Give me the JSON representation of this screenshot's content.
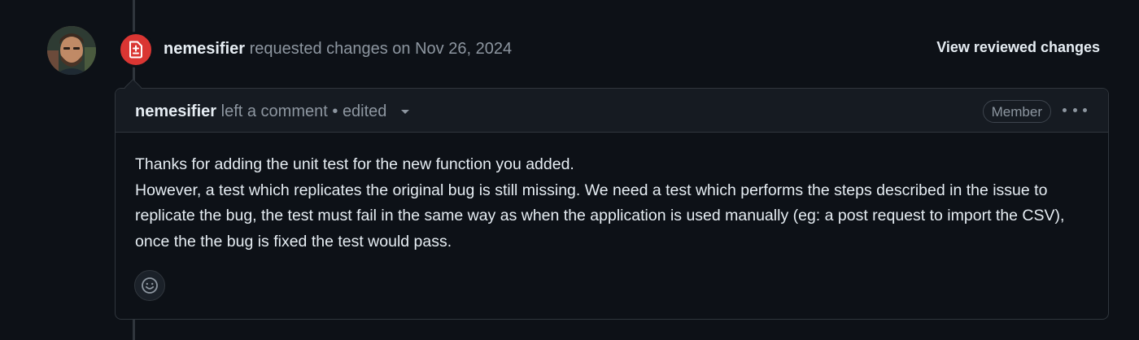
{
  "review": {
    "author": "nemesifier",
    "action_text": "requested changes on Nov 26, 2024",
    "view_changes_label": "View reviewed changes",
    "status_color": "#da3633",
    "status_icon": "file-diff-icon"
  },
  "comment": {
    "author": "nemesifier",
    "action_text": "left a comment",
    "separator": "•",
    "edited_label": "edited",
    "role_badge": "Member",
    "body_lines": [
      "Thanks for adding the unit test for the new function you added.",
      "However, a test which replicates the original bug is still missing. We need a test which performs the steps described in the issue to replicate the bug, the test must fail in the same way as when the application is used manually (eg: a post request to import the CSV), once the the bug is fixed the test would pass."
    ],
    "reaction_icon": "smiley-icon"
  }
}
